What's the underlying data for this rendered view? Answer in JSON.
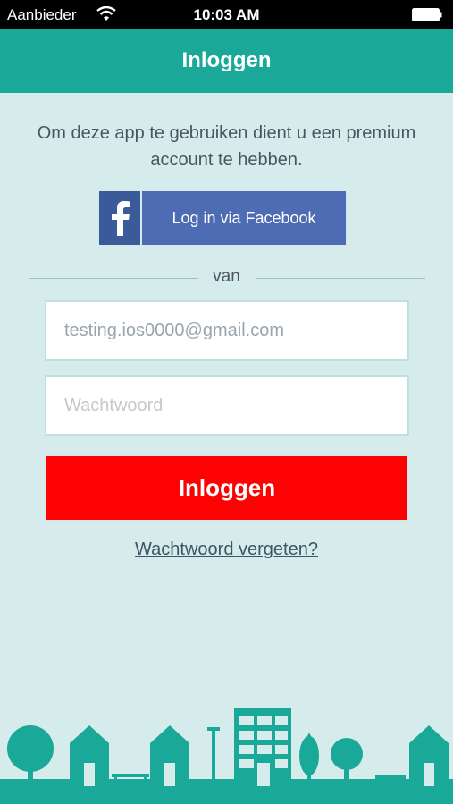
{
  "status_bar": {
    "carrier": "Aanbieder",
    "time": "10:03 AM",
    "wifi_icon": "wifi-icon",
    "battery_icon": "battery-icon"
  },
  "nav": {
    "title": "Inloggen"
  },
  "intro_text": "Om deze app te gebruiken dient u een premium account te hebben.",
  "facebook": {
    "logo_icon": "facebook-logo-icon",
    "label": "Log in via Facebook"
  },
  "divider_text": "van",
  "form": {
    "email_value": "testing.ios0000@gmail.com",
    "password_placeholder": "Wachtwoord"
  },
  "login_button": "Inloggen",
  "forgot_link": "Wachtwoord vergeten?",
  "colors": {
    "nav": "#1aa898",
    "background": "#d6ecec",
    "login_button": "#fc0202",
    "facebook": "#4d6cb3",
    "skyline": "#1aa898"
  }
}
